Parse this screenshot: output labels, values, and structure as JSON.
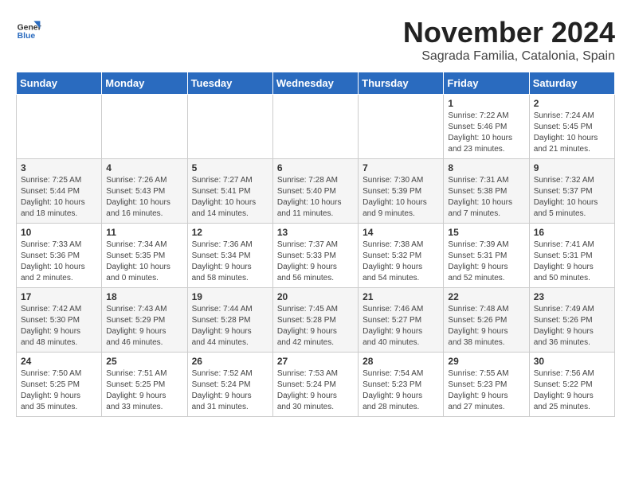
{
  "logo": {
    "general": "General",
    "blue": "Blue"
  },
  "header": {
    "month": "November 2024",
    "location": "Sagrada Familia, Catalonia, Spain"
  },
  "weekdays": [
    "Sunday",
    "Monday",
    "Tuesday",
    "Wednesday",
    "Thursday",
    "Friday",
    "Saturday"
  ],
  "weeks": [
    [
      {
        "day": "",
        "info": ""
      },
      {
        "day": "",
        "info": ""
      },
      {
        "day": "",
        "info": ""
      },
      {
        "day": "",
        "info": ""
      },
      {
        "day": "",
        "info": ""
      },
      {
        "day": "1",
        "info": "Sunrise: 7:22 AM\nSunset: 5:46 PM\nDaylight: 10 hours\nand 23 minutes."
      },
      {
        "day": "2",
        "info": "Sunrise: 7:24 AM\nSunset: 5:45 PM\nDaylight: 10 hours\nand 21 minutes."
      }
    ],
    [
      {
        "day": "3",
        "info": "Sunrise: 7:25 AM\nSunset: 5:44 PM\nDaylight: 10 hours\nand 18 minutes."
      },
      {
        "day": "4",
        "info": "Sunrise: 7:26 AM\nSunset: 5:43 PM\nDaylight: 10 hours\nand 16 minutes."
      },
      {
        "day": "5",
        "info": "Sunrise: 7:27 AM\nSunset: 5:41 PM\nDaylight: 10 hours\nand 14 minutes."
      },
      {
        "day": "6",
        "info": "Sunrise: 7:28 AM\nSunset: 5:40 PM\nDaylight: 10 hours\nand 11 minutes."
      },
      {
        "day": "7",
        "info": "Sunrise: 7:30 AM\nSunset: 5:39 PM\nDaylight: 10 hours\nand 9 minutes."
      },
      {
        "day": "8",
        "info": "Sunrise: 7:31 AM\nSunset: 5:38 PM\nDaylight: 10 hours\nand 7 minutes."
      },
      {
        "day": "9",
        "info": "Sunrise: 7:32 AM\nSunset: 5:37 PM\nDaylight: 10 hours\nand 5 minutes."
      }
    ],
    [
      {
        "day": "10",
        "info": "Sunrise: 7:33 AM\nSunset: 5:36 PM\nDaylight: 10 hours\nand 2 minutes."
      },
      {
        "day": "11",
        "info": "Sunrise: 7:34 AM\nSunset: 5:35 PM\nDaylight: 10 hours\nand 0 minutes."
      },
      {
        "day": "12",
        "info": "Sunrise: 7:36 AM\nSunset: 5:34 PM\nDaylight: 9 hours\nand 58 minutes."
      },
      {
        "day": "13",
        "info": "Sunrise: 7:37 AM\nSunset: 5:33 PM\nDaylight: 9 hours\nand 56 minutes."
      },
      {
        "day": "14",
        "info": "Sunrise: 7:38 AM\nSunset: 5:32 PM\nDaylight: 9 hours\nand 54 minutes."
      },
      {
        "day": "15",
        "info": "Sunrise: 7:39 AM\nSunset: 5:31 PM\nDaylight: 9 hours\nand 52 minutes."
      },
      {
        "day": "16",
        "info": "Sunrise: 7:41 AM\nSunset: 5:31 PM\nDaylight: 9 hours\nand 50 minutes."
      }
    ],
    [
      {
        "day": "17",
        "info": "Sunrise: 7:42 AM\nSunset: 5:30 PM\nDaylight: 9 hours\nand 48 minutes."
      },
      {
        "day": "18",
        "info": "Sunrise: 7:43 AM\nSunset: 5:29 PM\nDaylight: 9 hours\nand 46 minutes."
      },
      {
        "day": "19",
        "info": "Sunrise: 7:44 AM\nSunset: 5:28 PM\nDaylight: 9 hours\nand 44 minutes."
      },
      {
        "day": "20",
        "info": "Sunrise: 7:45 AM\nSunset: 5:28 PM\nDaylight: 9 hours\nand 42 minutes."
      },
      {
        "day": "21",
        "info": "Sunrise: 7:46 AM\nSunset: 5:27 PM\nDaylight: 9 hours\nand 40 minutes."
      },
      {
        "day": "22",
        "info": "Sunrise: 7:48 AM\nSunset: 5:26 PM\nDaylight: 9 hours\nand 38 minutes."
      },
      {
        "day": "23",
        "info": "Sunrise: 7:49 AM\nSunset: 5:26 PM\nDaylight: 9 hours\nand 36 minutes."
      }
    ],
    [
      {
        "day": "24",
        "info": "Sunrise: 7:50 AM\nSunset: 5:25 PM\nDaylight: 9 hours\nand 35 minutes."
      },
      {
        "day": "25",
        "info": "Sunrise: 7:51 AM\nSunset: 5:25 PM\nDaylight: 9 hours\nand 33 minutes."
      },
      {
        "day": "26",
        "info": "Sunrise: 7:52 AM\nSunset: 5:24 PM\nDaylight: 9 hours\nand 31 minutes."
      },
      {
        "day": "27",
        "info": "Sunrise: 7:53 AM\nSunset: 5:24 PM\nDaylight: 9 hours\nand 30 minutes."
      },
      {
        "day": "28",
        "info": "Sunrise: 7:54 AM\nSunset: 5:23 PM\nDaylight: 9 hours\nand 28 minutes."
      },
      {
        "day": "29",
        "info": "Sunrise: 7:55 AM\nSunset: 5:23 PM\nDaylight: 9 hours\nand 27 minutes."
      },
      {
        "day": "30",
        "info": "Sunrise: 7:56 AM\nSunset: 5:22 PM\nDaylight: 9 hours\nand 25 minutes."
      }
    ]
  ]
}
